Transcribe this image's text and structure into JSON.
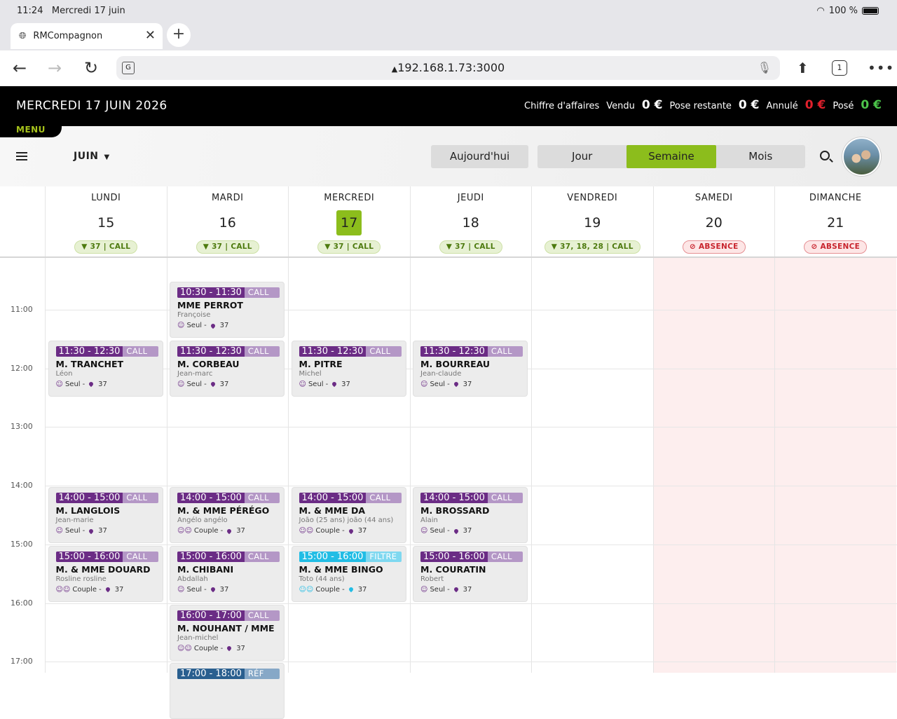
{
  "status": {
    "time": "11:24",
    "date": "Mercredi 17 juin",
    "battery": "100 %"
  },
  "browser": {
    "tab_title": "RMCompagnon",
    "url": "192.168.1.73:3000",
    "tab_count": "1"
  },
  "header": {
    "date": "MERCREDI 17 JUIN 2026",
    "menu": "MENU",
    "stats": {
      "ca_label": "Chiffre d'affaires",
      "vendu_label": "Vendu",
      "vendu_value": "0 €",
      "pose_restante_label": "Pose restante",
      "pose_restante_value": "0 €",
      "annule_label": "Annulé",
      "annule_value": "0 €",
      "pose_label": "Posé",
      "pose_value": "0 €"
    },
    "colors": {
      "annule": "#e2202c",
      "pose": "#4cc44a",
      "accent": "#8cbd1c"
    }
  },
  "toolbar": {
    "month": "JUIN",
    "today_button": "Aujourd'hui",
    "views": [
      "Jour",
      "Semaine",
      "Mois"
    ],
    "active_view": "Semaine"
  },
  "days": [
    {
      "name": "LUNDI",
      "num": "15",
      "chip": "37 | CALL",
      "chip_type": "call"
    },
    {
      "name": "MARDI",
      "num": "16",
      "chip": "37 | CALL",
      "chip_type": "call"
    },
    {
      "name": "MERCREDI",
      "num": "17",
      "chip": "37 | CALL",
      "chip_type": "call",
      "today": true
    },
    {
      "name": "JEUDI",
      "num": "18",
      "chip": "37 | CALL",
      "chip_type": "call"
    },
    {
      "name": "VENDREDI",
      "num": "19",
      "chip": "37, 18, 28 | CALL",
      "chip_type": "call"
    },
    {
      "name": "SAMEDI",
      "num": "20",
      "chip": "ABSENCE",
      "chip_type": "abs"
    },
    {
      "name": "DIMANCHE",
      "num": "21",
      "chip": "ABSENCE",
      "chip_type": "abs"
    }
  ],
  "hours": [
    "11:00",
    "12:00",
    "13:00",
    "14:00",
    "15:00",
    "16:00",
    "17:00"
  ],
  "events": [
    {
      "day": 1,
      "start": 10.5,
      "time": "10:30 - 11:30",
      "kind": "CALL",
      "name": "MME PERROT",
      "first": "Françoise",
      "who": "Seul",
      "zone": "37"
    },
    {
      "day": 0,
      "start": 11.5,
      "time": "11:30 - 12:30",
      "kind": "CALL",
      "name": "M. TRANCHET",
      "first": "Léon",
      "who": "Seul",
      "zone": "37"
    },
    {
      "day": 1,
      "start": 11.5,
      "time": "11:30 - 12:30",
      "kind": "CALL",
      "name": "M. CORBEAU",
      "first": "Jean-marc",
      "who": "Seul",
      "zone": "37"
    },
    {
      "day": 2,
      "start": 11.5,
      "time": "11:30 - 12:30",
      "kind": "CALL",
      "name": "M. PITRE",
      "first": "Michel",
      "who": "Seul",
      "zone": "37"
    },
    {
      "day": 3,
      "start": 11.5,
      "time": "11:30 - 12:30",
      "kind": "CALL",
      "name": "M. BOURREAU",
      "first": "Jean-claude",
      "who": "Seul",
      "zone": "37"
    },
    {
      "day": 0,
      "start": 14,
      "time": "14:00 - 15:00",
      "kind": "CALL",
      "name": "M. LANGLOIS",
      "first": "Jean-marie",
      "who": "Seul",
      "zone": "37"
    },
    {
      "day": 1,
      "start": 14,
      "time": "14:00 - 15:00",
      "kind": "CALL",
      "name": "M. & MME PÉRÉGO",
      "first": "Angélo angélo",
      "who": "Couple",
      "zone": "37"
    },
    {
      "day": 2,
      "start": 14,
      "time": "14:00 - 15:00",
      "kind": "CALL",
      "name": "M. & MME DA",
      "first": "João (25 ans) joão (44 ans)",
      "who": "Couple",
      "zone": "37"
    },
    {
      "day": 3,
      "start": 14,
      "time": "14:00 - 15:00",
      "kind": "CALL",
      "name": "M. BROSSARD",
      "first": "Alain",
      "who": "Seul",
      "zone": "37"
    },
    {
      "day": 0,
      "start": 15,
      "time": "15:00 - 16:00",
      "kind": "CALL",
      "name": "M. & MME DOUARD",
      "first": "Rosline rosline",
      "who": "Couple",
      "zone": "37"
    },
    {
      "day": 1,
      "start": 15,
      "time": "15:00 - 16:00",
      "kind": "CALL",
      "name": "M. CHIBANI",
      "first": "Abdallah",
      "who": "Seul",
      "zone": "37"
    },
    {
      "day": 2,
      "start": 15,
      "time": "15:00 - 16:00",
      "kind": "FILTRE",
      "name": "M. & MME BINGO",
      "first": "Toto (44 ans)",
      "who": "Couple",
      "zone": "37",
      "style": "cyan"
    },
    {
      "day": 3,
      "start": 15,
      "time": "15:00 - 16:00",
      "kind": "CALL",
      "name": "M. COURATIN",
      "first": "Robert",
      "who": "Seul",
      "zone": "37"
    },
    {
      "day": 1,
      "start": 16,
      "time": "16:00 - 17:00",
      "kind": "CALL",
      "name": "M. NOUHANT / MME",
      "first": "Jean-michel",
      "who": "Couple",
      "zone": "37"
    },
    {
      "day": 1,
      "start": 17,
      "time": "17:00 - 18:00",
      "kind": "RÉF",
      "name": "",
      "first": "",
      "who": "",
      "zone": "",
      "style": "blue"
    }
  ]
}
